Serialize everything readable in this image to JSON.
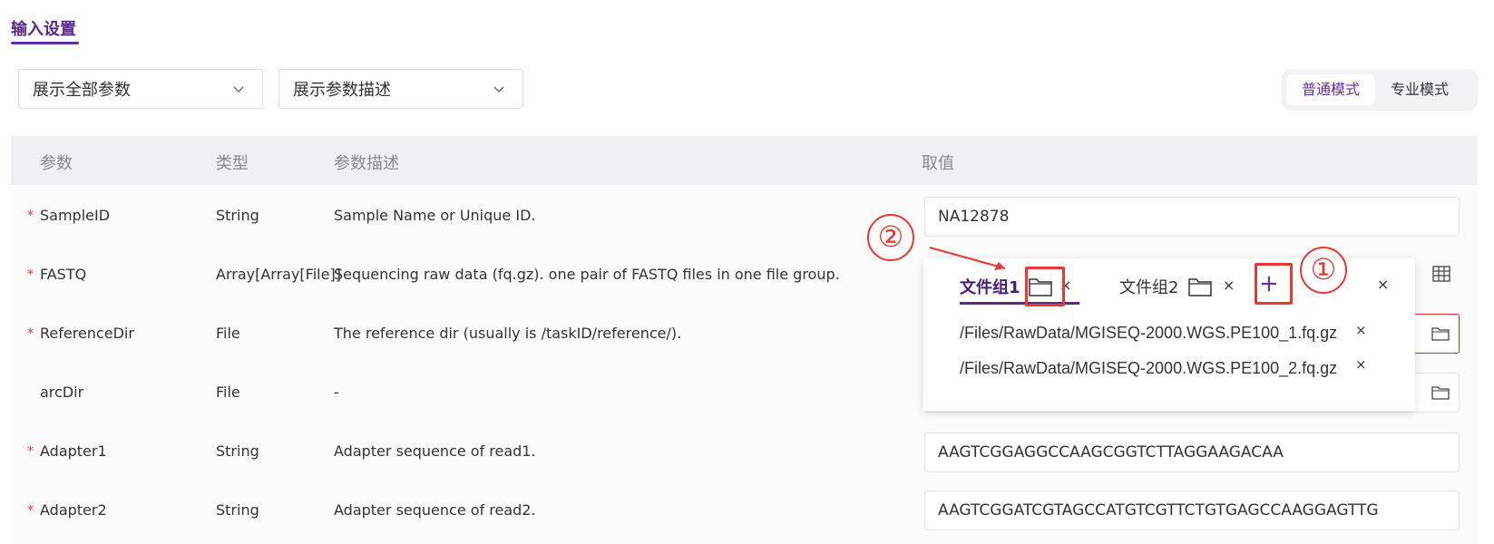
{
  "section": {
    "title": "输入设置"
  },
  "filters": {
    "param_filter": "展示全部参数",
    "desc_filter": "展示参数描述"
  },
  "mode": {
    "normal": "普通模式",
    "expert": "专业模式"
  },
  "table": {
    "headers": {
      "param": "参数",
      "type": "类型",
      "desc": "参数描述",
      "value": "取值"
    },
    "rows": [
      {
        "required": true,
        "name": "SampleID",
        "type": "String",
        "desc": "Sample Name or Unique ID.",
        "value": "NA12878"
      },
      {
        "required": true,
        "name": "FASTQ",
        "type": "Array[Array[File]]",
        "desc": "Sequencing raw data (fq.gz). one pair of FASTQ files in one file group.",
        "value": ""
      },
      {
        "required": true,
        "name": "ReferenceDir",
        "type": "File",
        "desc": "The reference dir (usually is /taskID/reference/).",
        "value": ""
      },
      {
        "required": false,
        "name": "arcDir",
        "type": "File",
        "desc": "-",
        "value": ""
      },
      {
        "required": true,
        "name": "Adapter1",
        "type": "String",
        "desc": "Adapter sequence of read1.",
        "value": "AAGTCGGAGGCCAAGCGGTCTTAGGAAGACAA"
      },
      {
        "required": true,
        "name": "Adapter2",
        "type": "String",
        "desc": "Adapter sequence of read2.",
        "value": "AAGTCGGATCGTAGCCATGTCGTTCTGTGAGCCAAGGAGTTG"
      }
    ],
    "required_mark": "*"
  },
  "popup": {
    "tab1": "文件组1",
    "tab2": "文件组2",
    "close": "×",
    "add": "+",
    "files": [
      "/Files/RawData/MGISEQ-2000.WGS.PE100_1.fq.gz",
      "/Files/RawData/MGISEQ-2000.WGS.PE100_2.fq.gz"
    ]
  },
  "annotations": {
    "one": "①",
    "two": "②"
  },
  "colors": {
    "accent": "#6a2c9a",
    "annotation": "#e53935",
    "required": "#e53935"
  }
}
